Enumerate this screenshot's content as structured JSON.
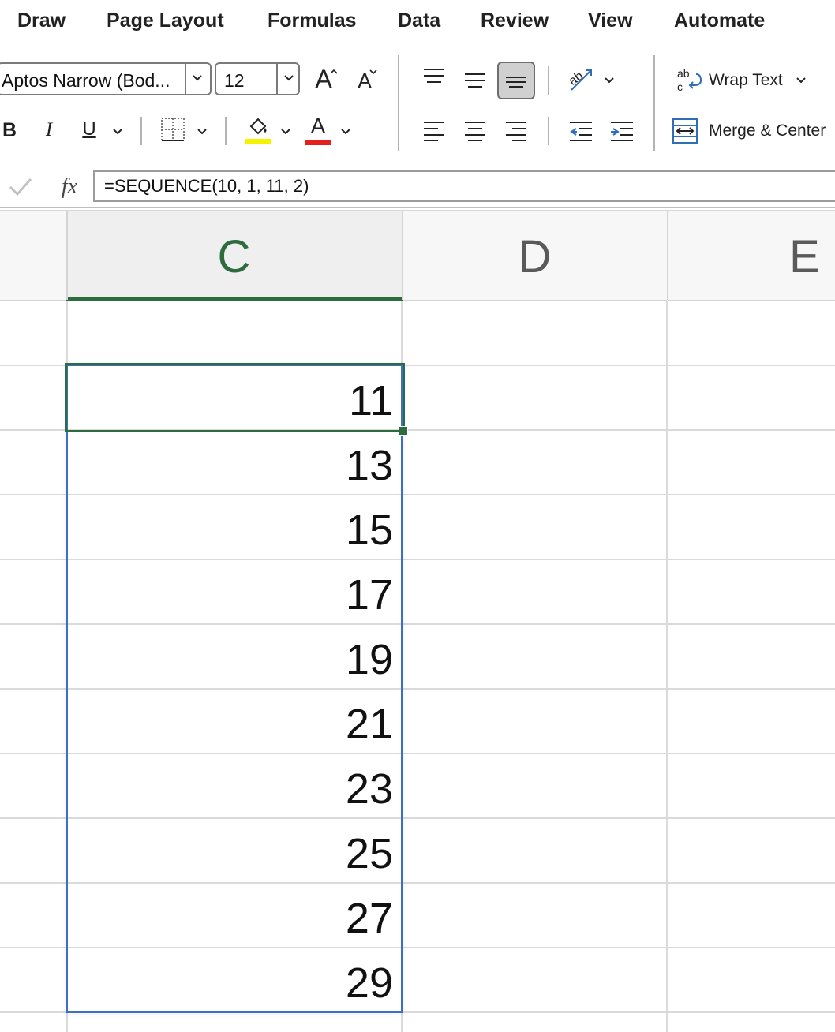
{
  "menu_tabs": [
    "Draw",
    "Page Layout",
    "Formulas",
    "Data",
    "Review",
    "View",
    "Automate"
  ],
  "ribbon": {
    "font_name": "Aptos Narrow (Bod...",
    "font_size": "12",
    "increase_font_glyph": "A",
    "decrease_font_glyph": "A",
    "bold_label": "B",
    "italic_label": "I",
    "underline_label": "U",
    "font_color_glyph": "A",
    "wrap_text_label": "Wrap Text",
    "merge_center_label": "Merge & Center",
    "fill_color": "#f5f200",
    "font_color": "#e3201b"
  },
  "formula_bar": {
    "fx_label": "fx",
    "formula": "=SEQUENCE(10, 1, 11, 2)"
  },
  "sheet": {
    "columns": [
      "C",
      "D",
      "E"
    ],
    "active_column": "C",
    "values": [
      "11",
      "13",
      "15",
      "17",
      "19",
      "21",
      "23",
      "25",
      "27",
      "29"
    ],
    "accent_color": "#2e6b3f",
    "spill_border_color": "#3b6fc4"
  }
}
